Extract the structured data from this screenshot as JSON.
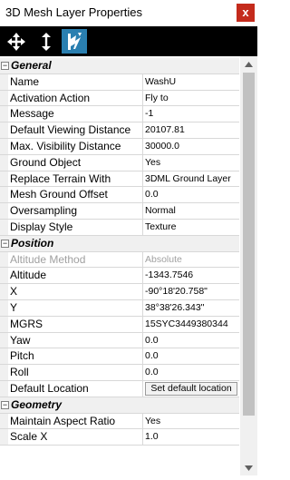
{
  "window": {
    "title": "3D Mesh Layer Properties",
    "close_label": "x"
  },
  "toolbar": {
    "icons": [
      "move-icon",
      "vertical-arrows-icon",
      "terrain-flag-icon"
    ],
    "active_color": "#2a7fb0"
  },
  "categories": {
    "general": {
      "toggle": "−",
      "label": "General"
    },
    "position": {
      "toggle": "−",
      "label": "Position"
    },
    "geometry": {
      "toggle": "−",
      "label": "Geometry"
    }
  },
  "general": [
    {
      "name": "Name",
      "value": "WashU"
    },
    {
      "name": "Activation Action",
      "value": "Fly to"
    },
    {
      "name": "Message",
      "value": "-1"
    },
    {
      "name": "Default Viewing Distance",
      "value": "20107.81"
    },
    {
      "name": "Max. Visibility Distance",
      "value": "30000.0"
    },
    {
      "name": "Ground Object",
      "value": "Yes"
    },
    {
      "name": "Replace Terrain With",
      "value": "3DML Ground Layer"
    },
    {
      "name": "Mesh Ground Offset",
      "value": "0.0"
    },
    {
      "name": "Oversampling",
      "value": "Normal"
    },
    {
      "name": "Display Style",
      "value": "Texture"
    }
  ],
  "position": [
    {
      "name": "Altitude Method",
      "value": "Absolute"
    },
    {
      "name": "Altitude",
      "value": "-1343.7546"
    },
    {
      "name": "X",
      "value": "-90°18'20.758\""
    },
    {
      "name": "Y",
      "value": "38°38'26.343\""
    },
    {
      "name": "MGRS",
      "value": "15SYC3449380344"
    },
    {
      "name": "Yaw",
      "value": "0.0"
    },
    {
      "name": "Pitch",
      "value": "0.0"
    },
    {
      "name": "Roll",
      "value": "0.0"
    },
    {
      "name": "Default Location",
      "button": "Set default location"
    }
  ],
  "geometry": [
    {
      "name": "Maintain Aspect Ratio",
      "value": "Yes"
    },
    {
      "name": "Scale X",
      "value": "1.0"
    }
  ]
}
